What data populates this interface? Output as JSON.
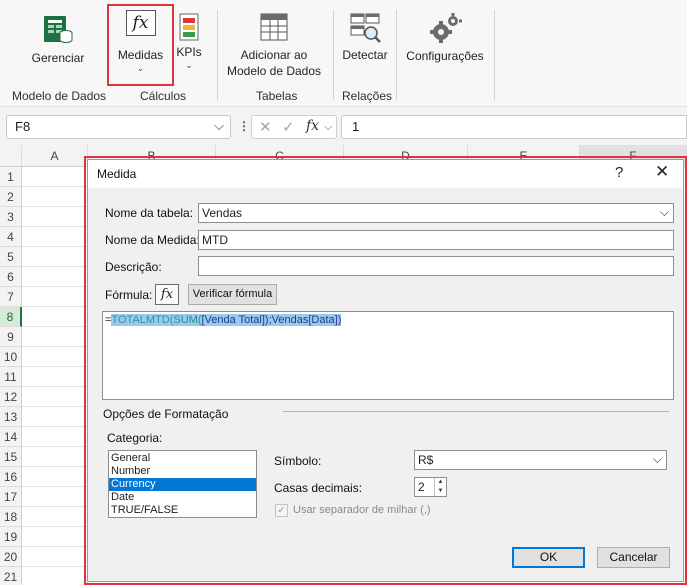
{
  "ribbon": {
    "buttons": {
      "gerenciar": "Gerenciar",
      "medidas": "Medidas",
      "kpis": "KPIs",
      "adicionar_line1": "Adicionar ao",
      "adicionar_line2": "Modelo de Dados",
      "detectar": "Detectar",
      "configuracoes": "Configurações"
    },
    "groups": {
      "modelo": "Modelo de Dados",
      "calculos": "Cálculos",
      "tabelas": "Tabelas",
      "relacoes": "Relações"
    },
    "icons": {
      "medidas": "fx"
    }
  },
  "formula_bar": {
    "name_box": "F8",
    "value": "1",
    "fx": "fx"
  },
  "grid": {
    "columns": [
      "A",
      "B",
      "C",
      "D",
      "E",
      "F"
    ],
    "rows": [
      "1",
      "2",
      "3",
      "4",
      "5",
      "6",
      "7",
      "8",
      "9",
      "10",
      "11",
      "12",
      "13",
      "14",
      "15",
      "16",
      "17",
      "18",
      "19",
      "20",
      "21"
    ],
    "selected_row": "8"
  },
  "dialog": {
    "title": "Medida",
    "help": "?",
    "close": "✕",
    "table_name_label": "Nome da tabela:",
    "table_name_value": "Vendas",
    "measure_name_label": "Nome da Medida:",
    "measure_name_value": "MTD",
    "description_label": "Descrição:",
    "description_value": "",
    "formula_label": "Fórmula:",
    "fx_button": "fx",
    "verify_button": "Verificar fórmula",
    "formula": {
      "eq": "=",
      "fn1": "TOTALMTD",
      "p1": "(",
      "fn2": "SUM",
      "p2": "(",
      "ref1": "[Venda Total]",
      "p3": ");",
      "ref2": "Vendas[Data]",
      "p4": ")"
    },
    "format_options_label": "Opções de Formatação",
    "category_label": "Categoria:",
    "categories": [
      "General",
      "Number",
      "Currency",
      "Date",
      "TRUE/FALSE"
    ],
    "selected_category": "Currency",
    "symbol_label": "Símbolo:",
    "symbol_value": "R$",
    "decimals_label": "Casas decimais:",
    "decimals_value": "2",
    "separator_label": "Usar separador de milhar (,)",
    "ok": "OK",
    "cancel": "Cancelar"
  },
  "colors": {
    "highlight": "#e0343c",
    "selection_blue": "#0078d7",
    "excel_green": "#217346"
  }
}
